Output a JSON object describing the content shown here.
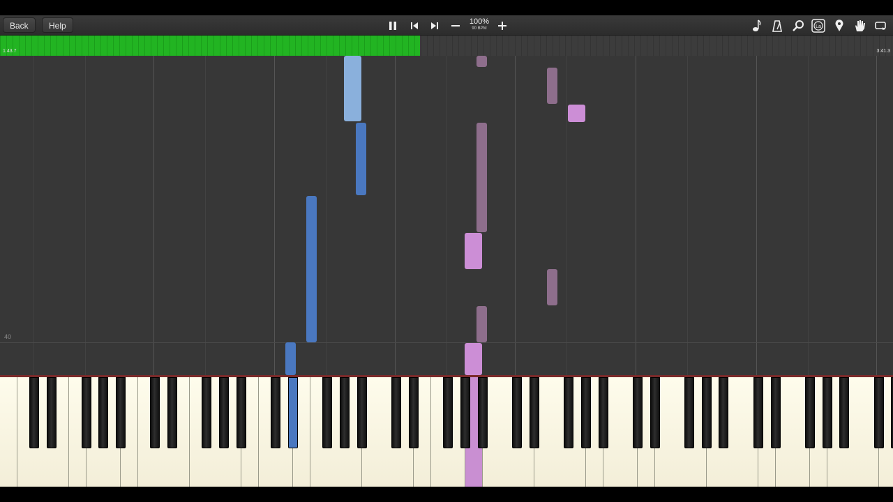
{
  "toolbar": {
    "back_label": "Back",
    "help_label": "Help",
    "zoom": "100%",
    "bpm": "90 BPM",
    "center_icons": [
      "pause-icon",
      "skip-back-icon",
      "skip-forward-icon",
      "minus-icon",
      "plus-icon"
    ],
    "right_icons": [
      "music-note-icon",
      "metronome-icon",
      "magnifier-icon",
      "label-icon",
      "location-pin-icon",
      "hand-icon",
      "loop-icon"
    ],
    "label_icon_text": "La"
  },
  "progress": {
    "current_time": "1:43.7",
    "total_time": "3:41.3",
    "fraction": 0.47,
    "fill_color": "#22b422"
  },
  "roll": {
    "measure_number": "40"
  },
  "colors": {
    "left_hand": "#4a78c0",
    "left_hand_light": "#8ab0dc",
    "right_hand": "#cc8ed6",
    "right_hand_dim": "#8e6e8c",
    "background": "#373737"
  }
}
